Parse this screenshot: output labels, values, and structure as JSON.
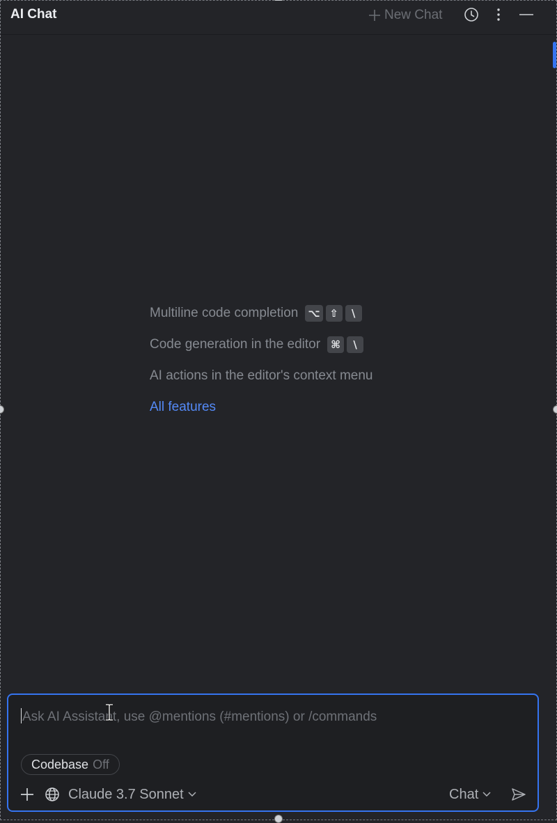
{
  "header": {
    "title": "AI Chat",
    "new_chat_label": "New Chat",
    "icons": [
      "plus-icon",
      "history-icon",
      "more-vertical-icon",
      "minimize-icon"
    ]
  },
  "tips": {
    "items": [
      {
        "label": "Multiline code completion",
        "keys": [
          "⌥",
          "⇧",
          "\\"
        ]
      },
      {
        "label": "Code generation in the editor",
        "keys": [
          "⌘",
          "\\"
        ]
      },
      {
        "label": "AI actions in the editor's context menu",
        "keys": []
      }
    ],
    "all_features_link": "All features"
  },
  "input": {
    "placeholder": "Ask AI Assistant, use @mentions (#mentions) or /commands",
    "value": "",
    "codebase_label": "Codebase",
    "codebase_state": "Off",
    "model": "Claude 3.7 Sonnet",
    "mode": "Chat",
    "icons": [
      "plus-icon",
      "globe-icon",
      "chevron-down-icon",
      "send-icon"
    ]
  },
  "colors": {
    "background": "#232428",
    "accent": "#3574f0",
    "link": "#548af7",
    "muted_text": "#868a91"
  }
}
